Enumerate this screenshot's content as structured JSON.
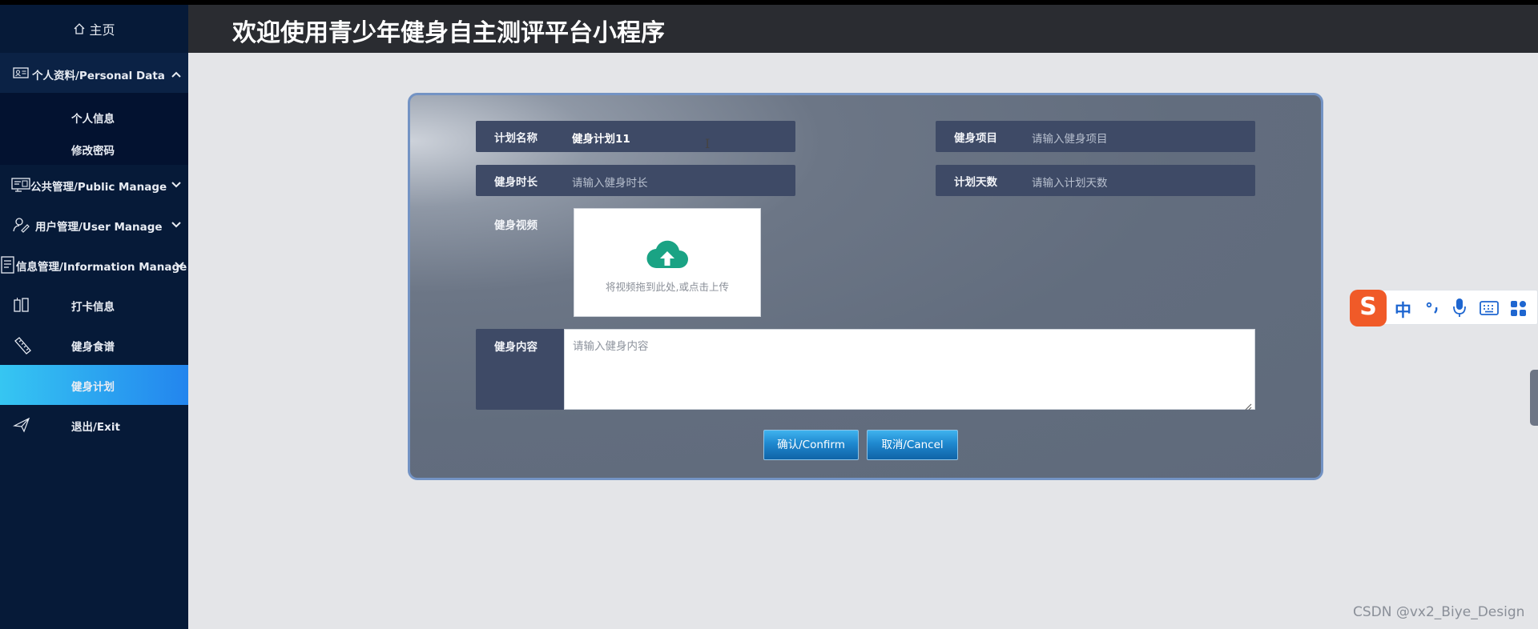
{
  "header": {
    "title": "欢迎使用青少年健身自主测评平台小程序"
  },
  "sidebar": {
    "home": "主页",
    "personal_data": "个人资料/Personal Data",
    "personal_sub": [
      "个人信息",
      "修改密码"
    ],
    "public_manage": "公共管理/Public Manage",
    "user_manage": "用户管理/User Manage",
    "information_manage": "信息管理/Information Manage",
    "checkin": "打卡信息",
    "diet": "健身食谱",
    "plan": "健身计划",
    "exit": "退出/Exit"
  },
  "form": {
    "plan_name": {
      "label": "计划名称",
      "value": "健身计划11"
    },
    "item": {
      "label": "健身项目",
      "placeholder": "请输入健身项目"
    },
    "duration": {
      "label": "健身时长",
      "placeholder": "请输入健身时长"
    },
    "days": {
      "label": "计划天数",
      "placeholder": "请输入计划天数"
    },
    "video": {
      "label": "健身视频",
      "upload_text": "将视频拖到此处,或点击上传"
    },
    "content": {
      "label": "健身内容",
      "placeholder": "请输入健身内容"
    },
    "confirm": "确认/Confirm",
    "cancel": "取消/Cancel"
  },
  "ime": {
    "logo": "S",
    "lang": "中"
  },
  "watermark": "CSDN @vx2_Biye_Design",
  "colors": {
    "sidebar": "#061a38",
    "active": "#2a9ff0",
    "panel_border": "#7393c4",
    "field_bg": "#3e4a66",
    "upload_icon": "#1aa384"
  }
}
